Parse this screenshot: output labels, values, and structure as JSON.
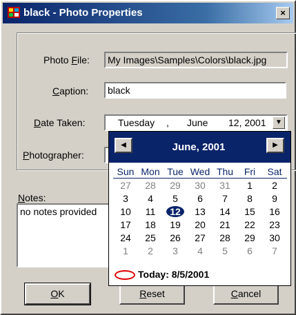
{
  "window": {
    "title": "black - Photo Properties",
    "close_glyph": "×"
  },
  "fields": {
    "photo_file": {
      "label_pre": "Photo ",
      "label_key": "F",
      "label_post": "ile:",
      "value": "My Images\\Samples\\Colors\\black.jpg"
    },
    "caption": {
      "label_pre": "",
      "label_key": "C",
      "label_post": "aption:",
      "value": "black"
    },
    "date_taken": {
      "label_pre": "",
      "label_key": "D",
      "label_post": "ate Taken:",
      "weekday": "Tuesday",
      "sep": ",",
      "month": "June",
      "day_year": "12, 2001"
    },
    "photographer": {
      "label_pre": "",
      "label_key": "P",
      "label_post": "hotographer:",
      "value": ""
    }
  },
  "notes": {
    "label_pre": "",
    "label_key": "N",
    "label_post": "otes:",
    "value": "no notes provided"
  },
  "buttons": {
    "ok": {
      "pre": "",
      "key": "O",
      "post": "K"
    },
    "reset": {
      "pre": "",
      "key": "R",
      "post": "eset"
    },
    "cancel": {
      "pre": "",
      "key": "C",
      "post": "ancel"
    }
  },
  "calendar": {
    "title": "June, 2001",
    "day_headers": [
      "Sun",
      "Mon",
      "Tue",
      "Wed",
      "Thu",
      "Fri",
      "Sat"
    ],
    "weeks": [
      [
        [
          "27",
          1
        ],
        [
          "28",
          1
        ],
        [
          "29",
          1
        ],
        [
          "30",
          1
        ],
        [
          "31",
          1
        ],
        [
          "1",
          0
        ],
        [
          "2",
          0
        ]
      ],
      [
        [
          "3",
          0
        ],
        [
          "4",
          0
        ],
        [
          "5",
          0
        ],
        [
          "6",
          0
        ],
        [
          "7",
          0
        ],
        [
          "8",
          0
        ],
        [
          "9",
          0
        ]
      ],
      [
        [
          "10",
          0
        ],
        [
          "11",
          0
        ],
        [
          "12",
          2
        ],
        [
          "13",
          0
        ],
        [
          "14",
          0
        ],
        [
          "15",
          0
        ],
        [
          "16",
          0
        ]
      ],
      [
        [
          "17",
          0
        ],
        [
          "18",
          0
        ],
        [
          "19",
          0
        ],
        [
          "20",
          0
        ],
        [
          "21",
          0
        ],
        [
          "22",
          0
        ],
        [
          "23",
          0
        ]
      ],
      [
        [
          "24",
          0
        ],
        [
          "25",
          0
        ],
        [
          "26",
          0
        ],
        [
          "27",
          0
        ],
        [
          "28",
          0
        ],
        [
          "29",
          0
        ],
        [
          "30",
          0
        ]
      ],
      [
        [
          "1",
          1
        ],
        [
          "2",
          1
        ],
        [
          "3",
          1
        ],
        [
          "4",
          1
        ],
        [
          "5",
          1
        ],
        [
          "6",
          1
        ],
        [
          "7",
          1
        ]
      ]
    ],
    "today_label": "Today: 8/5/2001"
  }
}
